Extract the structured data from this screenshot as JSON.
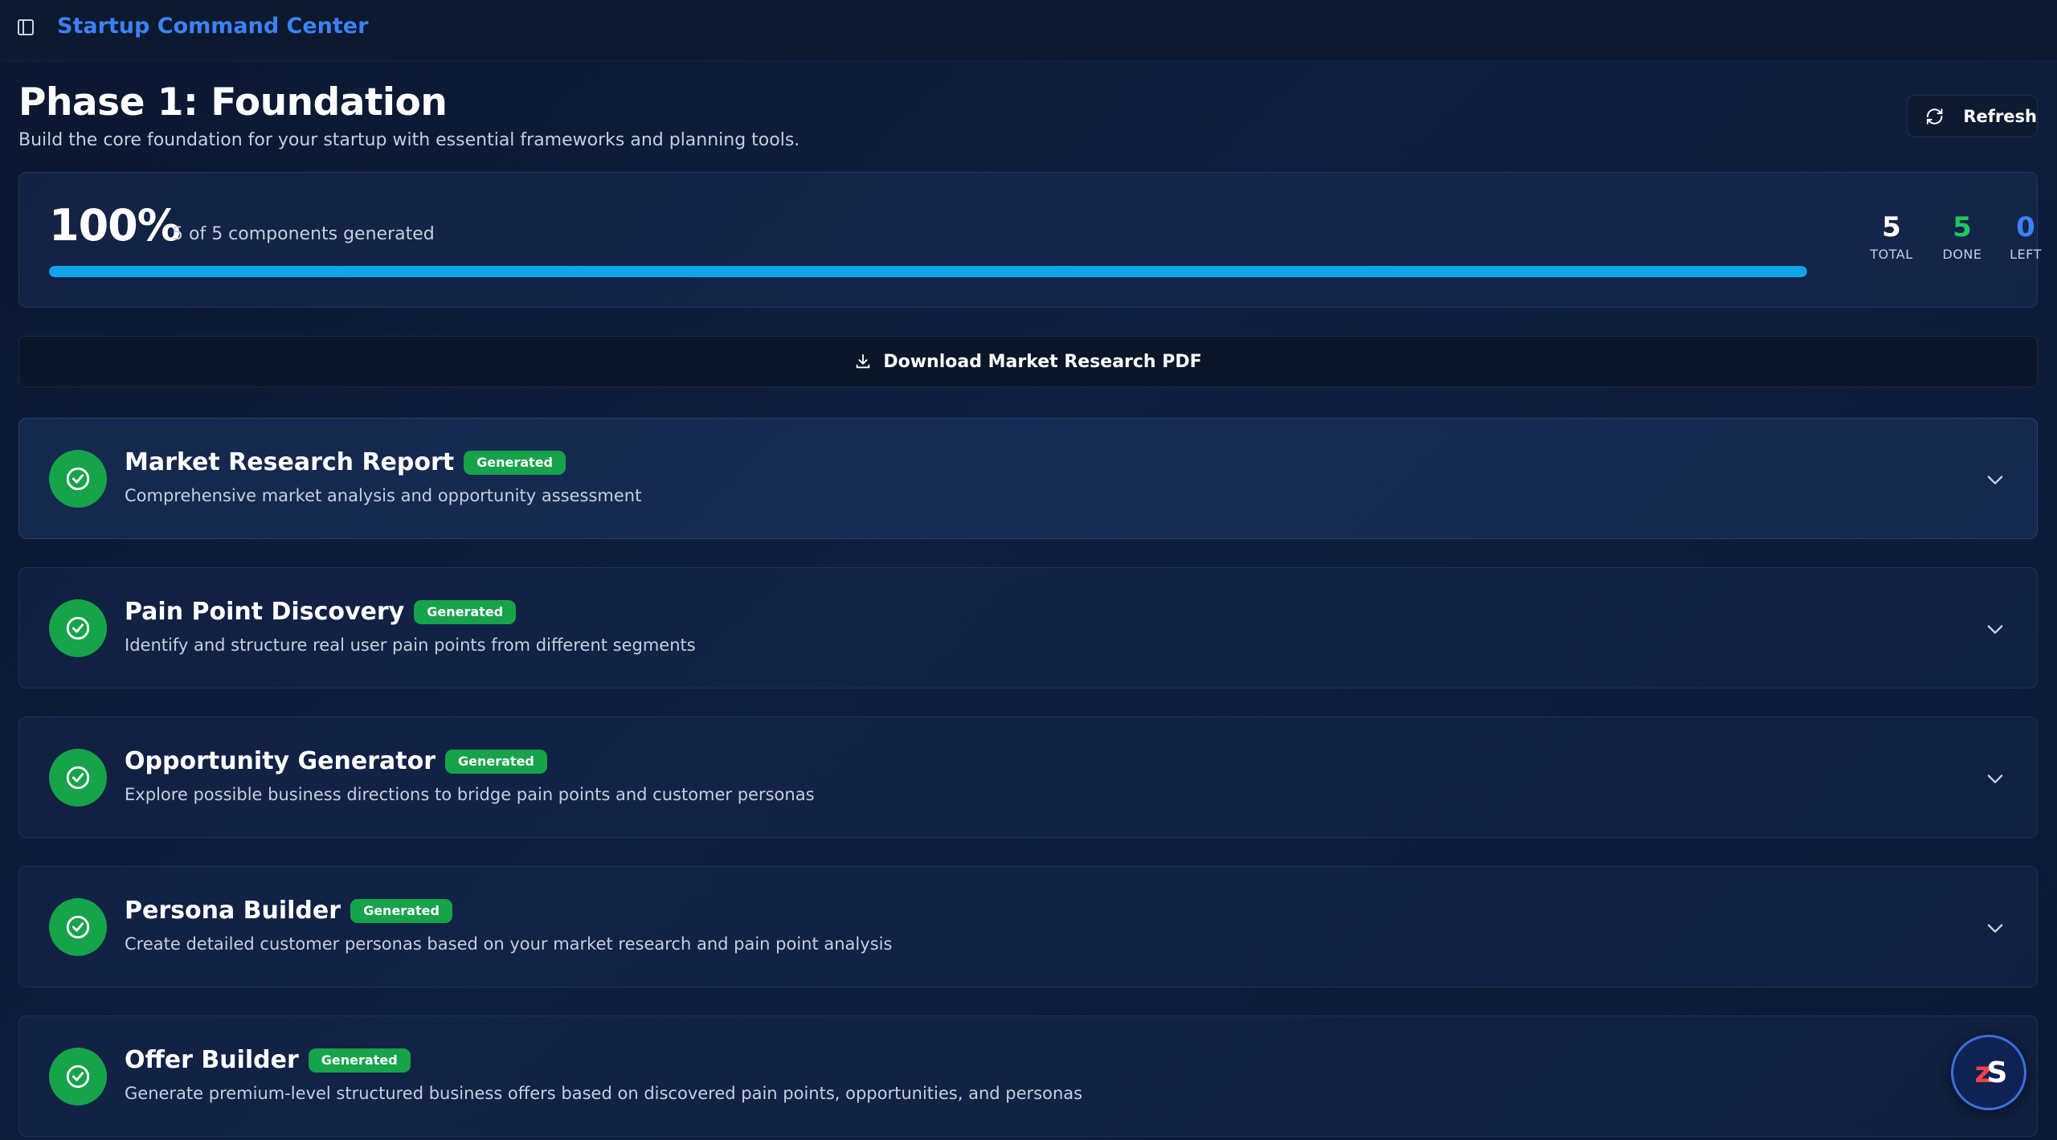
{
  "app": {
    "title": "Startup Command Center"
  },
  "header": {
    "title": "Phase 1: Foundation",
    "subtitle": "Build the core foundation for your startup with essential frameworks and planning tools.",
    "refresh_label": "Refresh"
  },
  "progress": {
    "percent_label": "100%",
    "percent_value": 100,
    "caption": "5 of 5 components generated",
    "stats": {
      "total": {
        "value": "5",
        "label": "TOTAL"
      },
      "done": {
        "value": "5",
        "label": "DONE"
      },
      "left": {
        "value": "0",
        "label": "LEFT"
      }
    }
  },
  "download": {
    "label": "Download Market Research PDF",
    "icon": "download-icon"
  },
  "components": [
    {
      "title": "Market Research Report",
      "badge": "Generated",
      "description": "Comprehensive market analysis and opportunity assessment"
    },
    {
      "title": "Pain Point Discovery",
      "badge": "Generated",
      "description": "Identify and structure real user pain points from different segments"
    },
    {
      "title": "Opportunity Generator",
      "badge": "Generated",
      "description": "Explore possible business directions to bridge pain points and customer personas"
    },
    {
      "title": "Persona Builder",
      "badge": "Generated",
      "description": "Create detailed customer personas based on your market research and pain point analysis"
    },
    {
      "title": "Offer Builder",
      "badge": "Generated",
      "description": "Generate premium-level structured business offers based on discovered pain points, opportunities, and personas"
    }
  ],
  "fab": {
    "logo_a": "z",
    "logo_b": "S"
  },
  "colors": {
    "accent_blue": "#3b82f6",
    "progress_fill": "#0ea5e9",
    "success_green": "#16a34a",
    "done_green": "#22c55e"
  }
}
